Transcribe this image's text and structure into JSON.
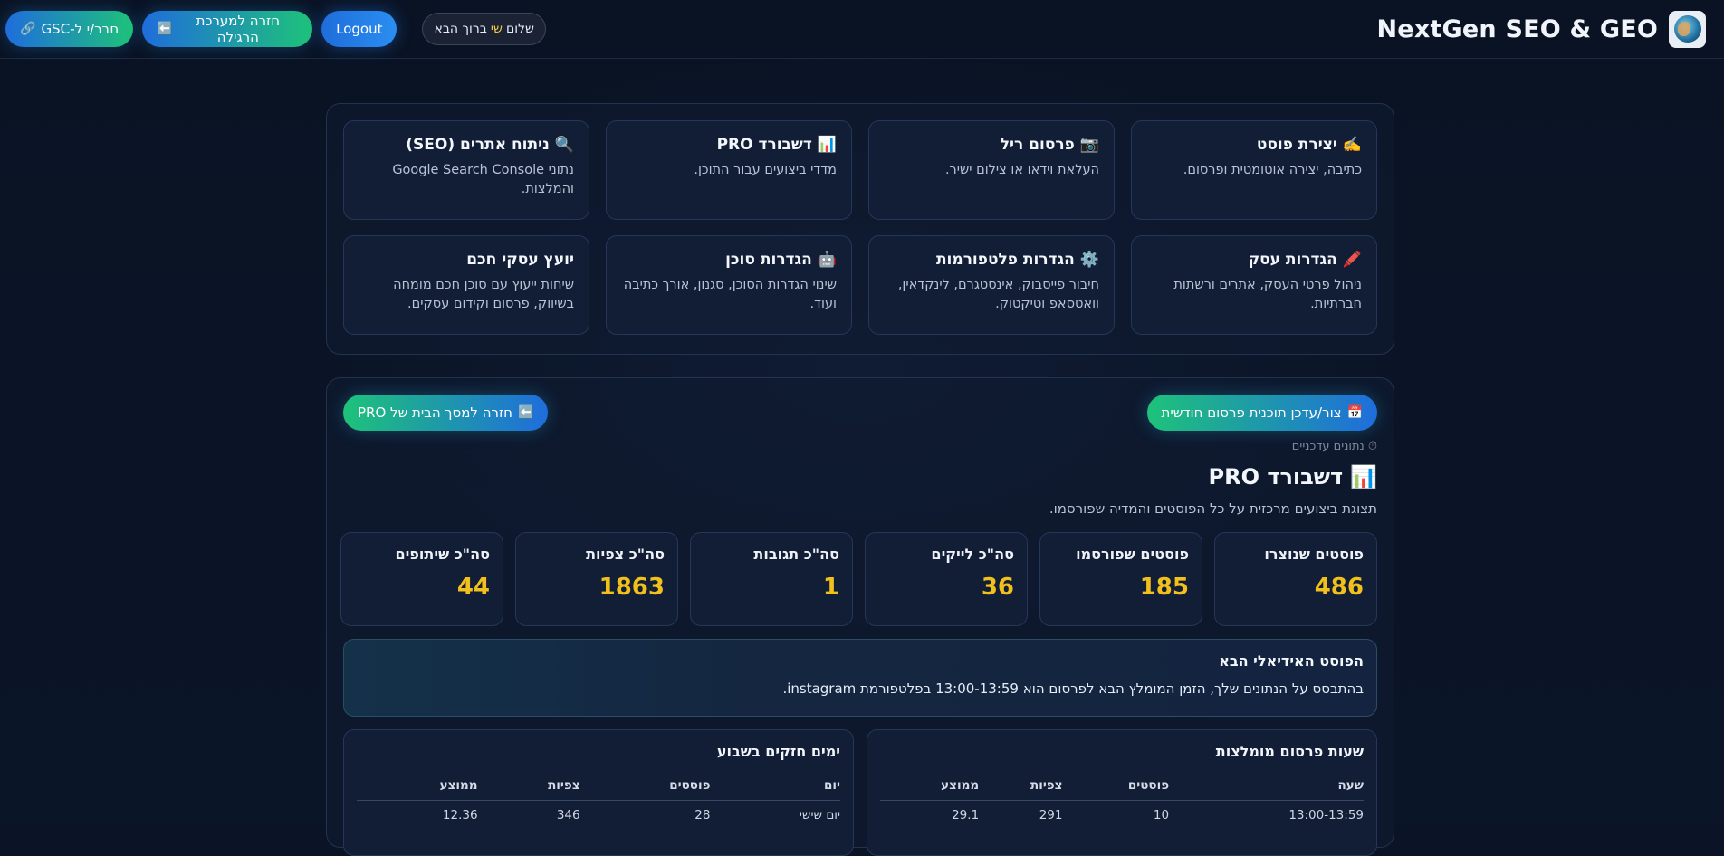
{
  "header": {
    "brand_title": "NextGen SEO & GEO",
    "logo_icon": "globe-brain-icon",
    "gsc_button": "חבר/י ל-GSC",
    "back_button": "חזרה למערכת הרגילה",
    "logout_button": "Logout",
    "greeting_prefix": "שלום",
    "greeting_user": "שי",
    "greeting_suffix": "ברוך הבא"
  },
  "tools": [
    {
      "icon": "✍️",
      "title": "יצירת פוסט",
      "desc": "כתיבה, יצירה אוטומטית ופרסום."
    },
    {
      "icon": "📷",
      "title": "פרסום ריל",
      "desc": "העלאת וידאו או צילום ישיר."
    },
    {
      "icon": "📊",
      "title": "דשבורד PRO",
      "desc": "מדדי ביצועים עבור התוכן."
    },
    {
      "icon": "🔍",
      "title": "ניתוח אתרים (SEO)",
      "desc": "נתוני Google Search Console והמלצות."
    },
    {
      "icon": "🖍️",
      "title": "הגדרות עסק",
      "desc": "ניהול פרטי העסק, אתרים ורשתות חברתיות."
    },
    {
      "icon": "⚙️",
      "title": "הגדרות פלטפורמות",
      "desc": "חיבור פייסבוק, אינסטגרם, לינקדאין, וואטסאפ וטיקטוק."
    },
    {
      "icon": "🤖",
      "title": "הגדרות סוכן",
      "desc": "שינוי הגדרות הסוכן, סגנון, אורך כתיבה ועוד."
    },
    {
      "icon": "",
      "title": "יועץ עסקי חכם",
      "desc": "שיחות ייעוץ עם סוכן חכם מומחה בשיווק, פרסום וקידום עסקים."
    }
  ],
  "dashboard": {
    "plan_button": "צור/עדכן תוכנית פרסום חודשית",
    "home_button": "חזרה למסך הבית של PRO",
    "updated_text": "⏱ נתונים עדכניים",
    "title": "דשבורד PRO",
    "subtitle": "תצוגת ביצועים מרכזית על כל הפוסטים והמדיה שפורסמו.",
    "stats": [
      {
        "label": "פוסטים שנוצרו",
        "value": "486"
      },
      {
        "label": "פוסטים שפורסמו",
        "value": "185"
      },
      {
        "label": "סה\"כ לייקים",
        "value": "36"
      },
      {
        "label": "סה\"כ תגובות",
        "value": "1"
      },
      {
        "label": "סה\"כ צפיות",
        "value": "1863"
      },
      {
        "label": "סה\"כ שיתופים",
        "value": "44"
      }
    ],
    "ideal_title": "הפוסט האידיאלי הבא",
    "ideal_text": "בהתבסס על הנתונים שלך, הזמן המומלץ הבא לפרסום הוא 13:00-13:59 בפלטפורמת instagram.",
    "hours_table": {
      "title": "שעות פרסום מומלצות",
      "headers": [
        "שעה",
        "פוסטים",
        "צפיות",
        "ממוצע"
      ],
      "rows": [
        [
          "13:00-13:59",
          "10",
          "291",
          "29.1"
        ]
      ]
    },
    "days_table": {
      "title": "ימים חזקים בשבוע",
      "headers": [
        "יום",
        "פוסטים",
        "צפיות",
        "ממוצע"
      ],
      "rows": [
        [
          "יום שישי",
          "28",
          "346",
          "12.36"
        ]
      ]
    },
    "accent_color": "#f2c01c"
  }
}
